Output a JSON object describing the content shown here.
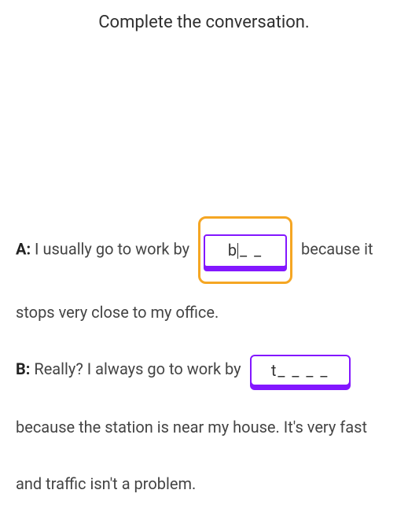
{
  "instruction": "Complete the conversation.",
  "lineA": {
    "speaker": "A:",
    "before": " I usually go to work by ",
    "blank": {
      "typed": "b",
      "remaining": "_ _",
      "active": true
    },
    "after": " because it stops very close to my office."
  },
  "lineB": {
    "speaker": "B:",
    "before": " Really? I always go to work by ",
    "blank": {
      "typed": "t",
      "remaining": "_ _ _ _",
      "active": false
    },
    "after": " because the station is near my house. It's very fast and traffic isn't a problem."
  }
}
